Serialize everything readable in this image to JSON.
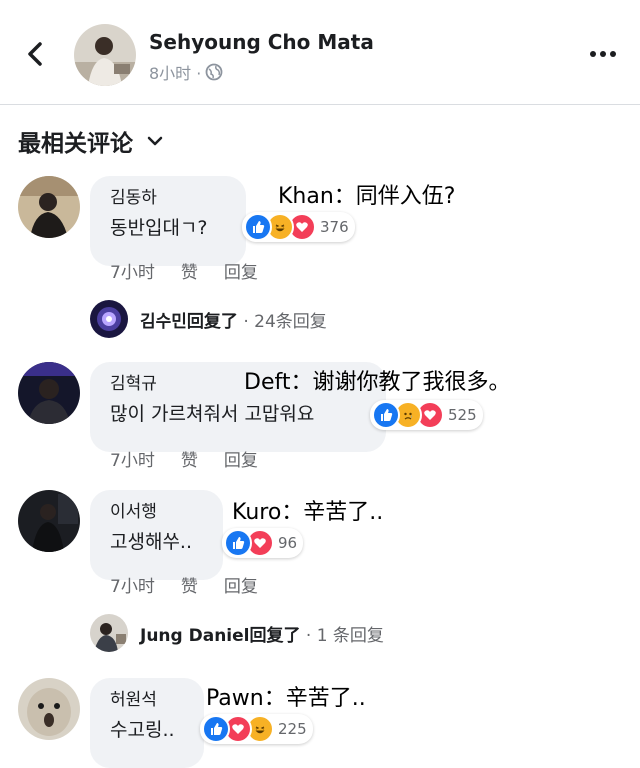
{
  "header": {
    "title": "Sehyoung Cho Mata",
    "time": "8小时 ·"
  },
  "sort_label": "最相关评论",
  "comments": [
    {
      "author": "김동하",
      "text": "동반입대ㄱ?",
      "overlay": "Khan：同伴入伍?",
      "reactions": [
        "like-icon",
        "haha-icon",
        "love-icon"
      ],
      "count": "376",
      "time": "7小时",
      "like_label": "赞",
      "reply_label": "回复",
      "reply": {
        "name": "김수민",
        "action": "回复了",
        "count": " · 24条回复"
      }
    },
    {
      "author": "김혁규",
      "text": "많이 가르쳐줘서 고맙워요",
      "overlay": "Deft：谢谢你教了我很多。",
      "reactions": [
        "like-icon",
        "sad-icon",
        "love-icon"
      ],
      "count": "525",
      "time": "7小时",
      "like_label": "赞",
      "reply_label": "回复"
    },
    {
      "author": "이서행",
      "text": "고생해쑤..",
      "overlay": "Kuro：辛苦了..",
      "reactions": [
        "like-icon",
        "love-icon"
      ],
      "count": "96",
      "time": "7小时",
      "like_label": "赞",
      "reply_label": "回复",
      "reply": {
        "name": "Jung Daniel",
        "action": "回复了",
        "count": " · 1 条回复"
      }
    },
    {
      "author": "허원석",
      "text": "수고링..",
      "overlay": "Pawn：辛苦了..",
      "reactions": [
        "like-icon",
        "love-icon",
        "haha-icon"
      ],
      "count": "225"
    }
  ],
  "colors": {
    "like": "#1877f2",
    "love": "#f33e58",
    "haha": "#f7b125",
    "bubble": "#f0f2f5",
    "meta": "#65676b"
  }
}
